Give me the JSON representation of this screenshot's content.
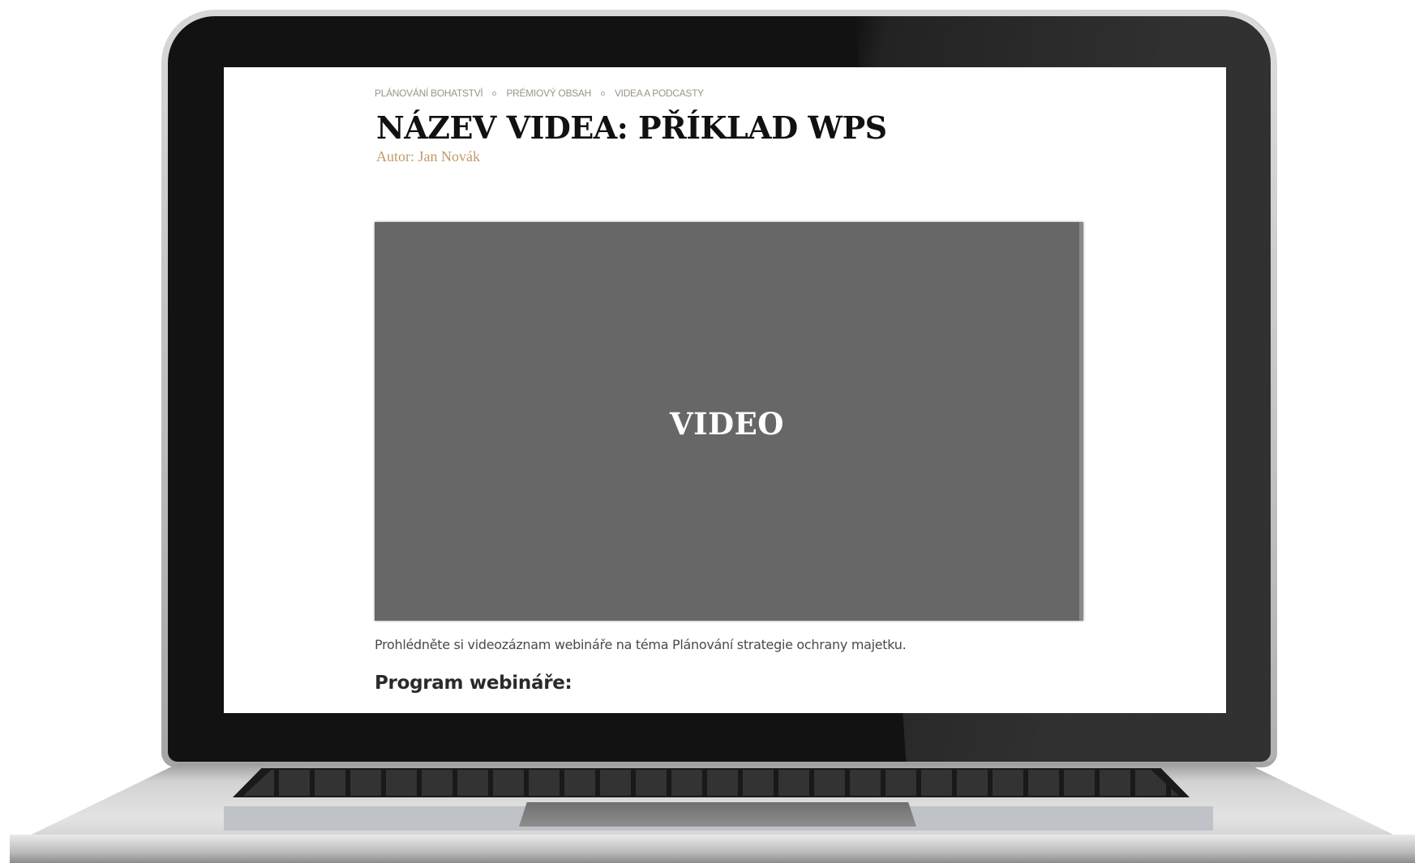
{
  "breadcrumb": {
    "items": [
      "PLÁNOVÁNÍ BOHATSTVÍ",
      "PRÉMIOVÝ OBSAH",
      "VIDEA A PODCASTY"
    ]
  },
  "page": {
    "title": "NÁZEV VIDEA: PŘÍKLAD WPS",
    "author": "Autor: Jan Novák"
  },
  "video": {
    "label": "VIDEO",
    "background": "#676767"
  },
  "description": "Prohlédněte si videozáznam webináře na téma Plánování strategie ochrany majetku.",
  "program_heading": "Program webináře:",
  "colors": {
    "author": "#c09a6b",
    "breadcrumb": "#9b9488",
    "title": "#111111"
  }
}
